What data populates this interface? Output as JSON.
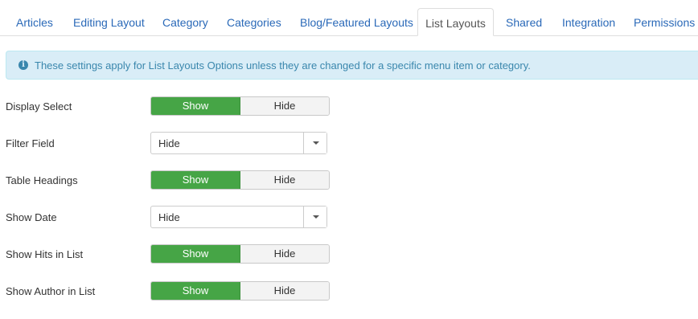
{
  "tabs": [
    {
      "label": "Articles",
      "active": false
    },
    {
      "label": "Editing Layout",
      "active": false
    },
    {
      "label": "Category",
      "active": false
    },
    {
      "label": "Categories",
      "active": false
    },
    {
      "label": "Blog/Featured Layouts",
      "active": false
    },
    {
      "label": "List Layouts",
      "active": true
    },
    {
      "label": "Shared",
      "active": false
    },
    {
      "label": "Integration",
      "active": false
    },
    {
      "label": "Permissions",
      "active": false
    }
  ],
  "alert": {
    "icon": "info-icon",
    "icon_glyph": "i",
    "text": "These settings apply for List Layouts Options unless they are changed for a specific menu item or category."
  },
  "fields": {
    "display_select": {
      "label": "Display Select",
      "show": "Show",
      "hide": "Hide",
      "selected": "Show"
    },
    "filter_field": {
      "label": "Filter Field",
      "value": "Hide"
    },
    "table_headings": {
      "label": "Table Headings",
      "show": "Show",
      "hide": "Hide",
      "selected": "Show"
    },
    "show_date": {
      "label": "Show Date",
      "value": "Hide"
    },
    "show_hits": {
      "label": "Show Hits in List",
      "show": "Show",
      "hide": "Hide",
      "selected": "Show"
    },
    "show_author": {
      "label": "Show Author in List",
      "show": "Show",
      "hide": "Hide",
      "selected": "Show"
    }
  },
  "colors": {
    "tab_link": "#2a69b8",
    "active_toggle": "#46a546",
    "alert_bg": "#d9edf7",
    "alert_text": "#3a87ad"
  }
}
